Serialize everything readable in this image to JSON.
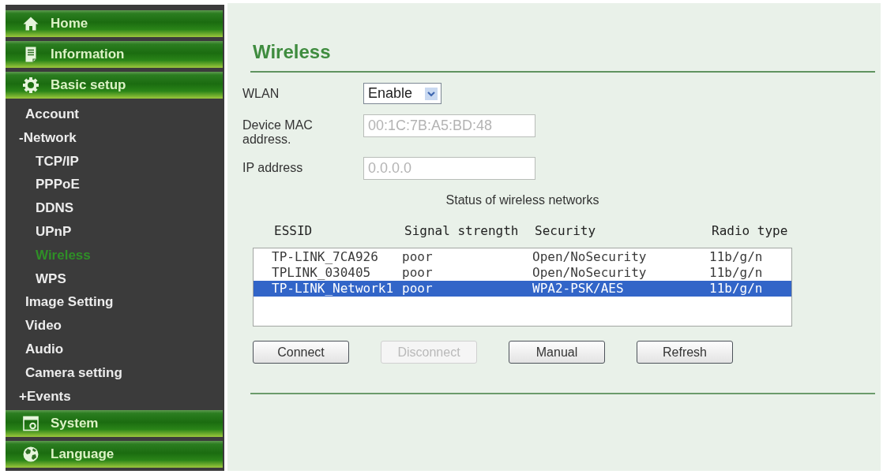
{
  "sidebar": {
    "sections": [
      {
        "label": "Home"
      },
      {
        "label": "Information"
      },
      {
        "label": "Basic setup",
        "children": [
          {
            "label": "Account",
            "kind": "page",
            "selected": false
          },
          {
            "label": "-Network",
            "kind": "folder",
            "selected": false,
            "children": [
              {
                "label": "TCP/IP",
                "selected": false
              },
              {
                "label": "PPPoE",
                "selected": false
              },
              {
                "label": "DDNS",
                "selected": false
              },
              {
                "label": "UPnP",
                "selected": false
              },
              {
                "label": "Wireless",
                "selected": true
              },
              {
                "label": "WPS",
                "selected": false
              }
            ]
          },
          {
            "label": "Image Setting",
            "kind": "page",
            "selected": false
          },
          {
            "label": "Video",
            "kind": "page",
            "selected": false
          },
          {
            "label": "Audio",
            "kind": "page",
            "selected": false
          },
          {
            "label": "Camera setting",
            "kind": "page",
            "selected": false
          },
          {
            "label": "+Events",
            "kind": "folder",
            "selected": false
          }
        ]
      },
      {
        "label": "System"
      },
      {
        "label": "Language"
      }
    ]
  },
  "content": {
    "title": "Wireless",
    "fields": [
      {
        "label": "WLAN",
        "kind": "select",
        "value": "Enable",
        "disabled": false
      },
      {
        "label": "Device MAC address.",
        "kind": "text",
        "value": "00:1C:7B:A5:BD:48",
        "disabled": true
      },
      {
        "label": "IP address",
        "kind": "text",
        "value": "0.0.0.0",
        "disabled": true
      }
    ],
    "networks": {
      "caption": "Status of wireless networks",
      "columns": [
        "ESSID",
        "Signal strength",
        "Security",
        "Radio type"
      ],
      "rows": [
        {
          "cells": [
            "TP-LINK_7CA926",
            "poor",
            "Open/NoSecurity",
            "11b/g/n"
          ],
          "selected": false
        },
        {
          "cells": [
            "TPLINK_030405",
            "poor",
            "Open/NoSecurity",
            "11b/g/n"
          ],
          "selected": false
        },
        {
          "cells": [
            "TP-LINK_Network1",
            "poor",
            "WPA2-PSK/AES",
            "11b/g/n"
          ],
          "selected": true
        }
      ]
    },
    "buttons": [
      {
        "label": "Connect",
        "disabled": false
      },
      {
        "label": "Disconnect",
        "disabled": true
      },
      {
        "label": "Manual",
        "disabled": false
      },
      {
        "label": "Refresh",
        "disabled": false
      }
    ]
  }
}
